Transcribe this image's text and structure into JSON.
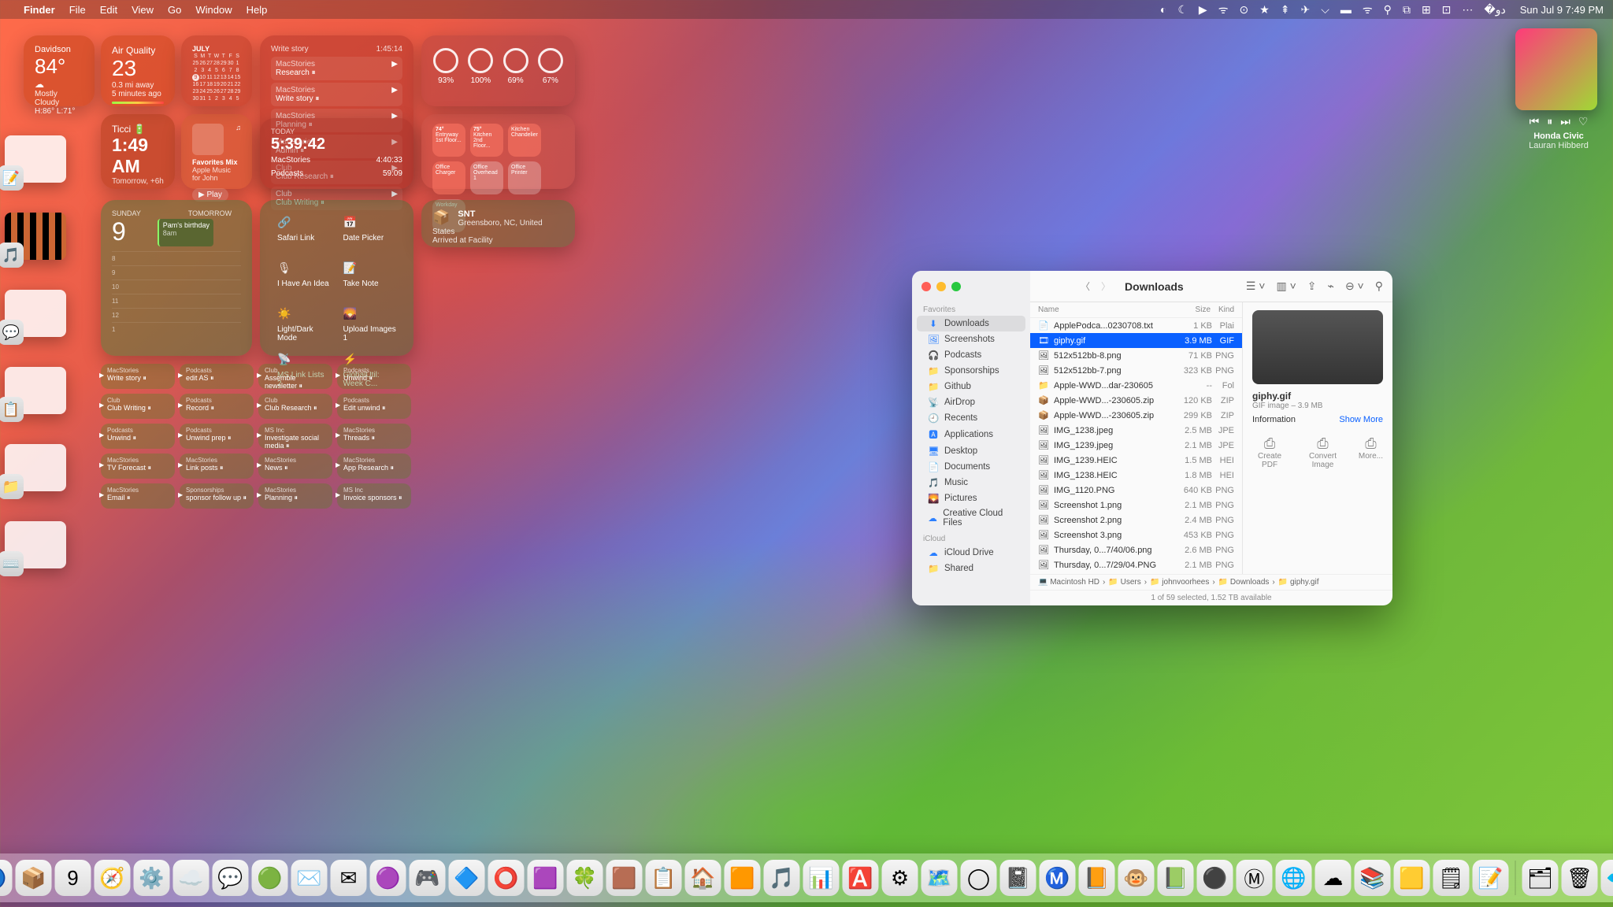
{
  "menubar": {
    "app": "Finder",
    "menus": [
      "File",
      "Edit",
      "View",
      "Go",
      "Window",
      "Help"
    ],
    "clock": "Sun Jul 9  7:49 PM"
  },
  "weather": {
    "loc": "Davidson",
    "deg": "84°",
    "cond": "Mostly Cloudy",
    "hilo": "H:86° L:71°"
  },
  "airquality": {
    "label": "Air Quality",
    "val": "23",
    "dist": "0.3 mi away",
    "ago": "5 minutes ago"
  },
  "calendar_mini": {
    "month": "JULY",
    "today": 9
  },
  "tasks": {
    "header_left": "Write story",
    "header_right": "1:45:14",
    "rows": [
      {
        "cat": "MacStories",
        "t": "Research"
      },
      {
        "cat": "MacStories",
        "t": "Write story"
      },
      {
        "cat": "MacStories",
        "t": "Planning"
      },
      {
        "cat": "MacStories",
        "t": "Admin"
      },
      {
        "cat": "Club",
        "t": "Club Research"
      },
      {
        "cat": "Club",
        "t": "Club Writing"
      }
    ]
  },
  "battery": {
    "labels": [
      "93%",
      "100%",
      "69%",
      "67%"
    ]
  },
  "clock": {
    "name": "Ticci",
    "time": "1:49 AM",
    "sub": "Tomorrow, +6h"
  },
  "music": {
    "title": "Favorites Mix",
    "sub": "Apple Music for John",
    "play": "▶ Play"
  },
  "podcast": {
    "today_label": "TODAY",
    "elapsed": "5:39:42",
    "rows": [
      [
        "MacStories",
        "4:40:33"
      ],
      [
        "Podcasts",
        "59:09"
      ]
    ]
  },
  "home_tiles": [
    {
      "t": "74°",
      "s": "Entryway 1st Floor..."
    },
    {
      "t": "75°",
      "s": "Kitchen 2nd Floor..."
    },
    {
      "t": "",
      "s": "Kitchen Chandelier"
    },
    {
      "t": "",
      "s": "Office Charger"
    },
    {
      "t": "",
      "s": "Office Overhead 1"
    },
    {
      "t": "",
      "s": "Office Printer"
    },
    {
      "t": "",
      "s": "Workday"
    }
  ],
  "big_cal": {
    "day_label": "SUNDAY",
    "daynum": "9",
    "tomorrow": "TOMORROW",
    "ev1": "Pam's birthday",
    "ev2": "8am",
    "hours": [
      "8",
      "9",
      "10",
      "11",
      "12",
      "1"
    ]
  },
  "shortcuts_cells": [
    {
      "ic": "🔗",
      "t": "Safari Link"
    },
    {
      "ic": "📅",
      "t": "Date Picker"
    },
    {
      "ic": "🎙",
      "t": "I Have An Idea"
    },
    {
      "ic": "📝",
      "t": "Take Note"
    },
    {
      "ic": "☀️",
      "t": "Light/Dark Mode"
    },
    {
      "ic": "🌄",
      "t": "Upload Images 1"
    },
    {
      "ic": "📡",
      "t": "MS Link Lists 2"
    },
    {
      "ic": "⚡",
      "t": "GlobalUtil: Week C..."
    }
  ],
  "ship": {
    "code": "SNT",
    "loc": "Greensboro, NC, United States",
    "status": "Arrived at Facility"
  },
  "notes": [
    {
      "c": "MacStories",
      "t": "Write story ⏸"
    },
    {
      "c": "Podcasts",
      "t": "edit AS ⏸"
    },
    {
      "c": "Club",
      "t": "Assemble newsletter ⏸"
    },
    {
      "c": "Podcasts",
      "t": "Unwind ⏸"
    },
    {
      "c": "Club",
      "t": "Club Writing ⏸"
    },
    {
      "c": "Podcasts",
      "t": "Record ⏸"
    },
    {
      "c": "Club",
      "t": "Club Research ⏸"
    },
    {
      "c": "Podcasts",
      "t": "Edit unwind ⏸"
    },
    {
      "c": "Podcasts",
      "t": "Unwind ⏸"
    },
    {
      "c": "Podcasts",
      "t": "Unwind prep ⏸"
    },
    {
      "c": "MS Inc",
      "t": "Investigate social media ⏸"
    },
    {
      "c": "MacStories",
      "t": "Threads ⏸"
    },
    {
      "c": "MacStories",
      "t": "TV Forecast ⏸"
    },
    {
      "c": "MacStories",
      "t": "Link posts ⏸"
    },
    {
      "c": "MacStories",
      "t": "News ⏸"
    },
    {
      "c": "MacStories",
      "t": "App Research ⏸"
    },
    {
      "c": "MacStories",
      "t": "Email ⏸"
    },
    {
      "c": "Sponsorships",
      "t": "sponsor follow up ⏸"
    },
    {
      "c": "MacStories",
      "t": "Planning ⏸"
    },
    {
      "c": "MS Inc",
      "t": "Invoice sponsors ⏸"
    }
  ],
  "now_playing": {
    "title": "Honda Civic",
    "artist": "Lauran Hibberd"
  },
  "finder": {
    "title": "Downloads",
    "sidebar": {
      "sec_fav": "Favorites",
      "fav": [
        {
          "ic": "⬇",
          "t": "Downloads",
          "sel": true
        },
        {
          "ic": "🖼",
          "t": "Screenshots"
        },
        {
          "ic": "🎧",
          "t": "Podcasts"
        },
        {
          "ic": "📁",
          "t": "Sponsorships"
        },
        {
          "ic": "📁",
          "t": "Github"
        },
        {
          "ic": "📡",
          "t": "AirDrop"
        },
        {
          "ic": "🕘",
          "t": "Recents"
        },
        {
          "ic": "🅰",
          "t": "Applications"
        },
        {
          "ic": "🖥",
          "t": "Desktop"
        },
        {
          "ic": "📄",
          "t": "Documents"
        },
        {
          "ic": "🎵",
          "t": "Music"
        },
        {
          "ic": "🌄",
          "t": "Pictures"
        },
        {
          "ic": "☁",
          "t": "Creative Cloud Files"
        }
      ],
      "sec_icloud": "iCloud",
      "icloud": [
        {
          "ic": "☁",
          "t": "iCloud Drive"
        },
        {
          "ic": "📁",
          "t": "Shared"
        }
      ]
    },
    "cols": {
      "name": "Name",
      "size": "Size",
      "kind": "Kind"
    },
    "files": [
      {
        "ic": "📄",
        "n": "ApplePodca...0230708.txt",
        "s": "1 KB",
        "k": "Plai"
      },
      {
        "ic": "🎞",
        "n": "giphy.gif",
        "s": "3.9 MB",
        "k": "GIF",
        "sel": true
      },
      {
        "ic": "🖼",
        "n": "512x512bb-8.png",
        "s": "71 KB",
        "k": "PNG"
      },
      {
        "ic": "🖼",
        "n": "512x512bb-7.png",
        "s": "323 KB",
        "k": "PNG"
      },
      {
        "ic": "📁",
        "n": "Apple-WWD...dar-230605",
        "s": "--",
        "k": "Fol"
      },
      {
        "ic": "📦",
        "n": "Apple-WWD...-230605.zip",
        "s": "120 KB",
        "k": "ZIP"
      },
      {
        "ic": "📦",
        "n": "Apple-WWD...-230605.zip",
        "s": "299 KB",
        "k": "ZIP"
      },
      {
        "ic": "🖼",
        "n": "IMG_1238.jpeg",
        "s": "2.5 MB",
        "k": "JPE"
      },
      {
        "ic": "🖼",
        "n": "IMG_1239.jpeg",
        "s": "2.1 MB",
        "k": "JPE"
      },
      {
        "ic": "🖼",
        "n": "IMG_1239.HEIC",
        "s": "1.5 MB",
        "k": "HEI"
      },
      {
        "ic": "🖼",
        "n": "IMG_1238.HEIC",
        "s": "1.8 MB",
        "k": "HEI"
      },
      {
        "ic": "🖼",
        "n": "IMG_1120.PNG",
        "s": "640 KB",
        "k": "PNG"
      },
      {
        "ic": "🖼",
        "n": "Screenshot 1.png",
        "s": "2.1 MB",
        "k": "PNG"
      },
      {
        "ic": "🖼",
        "n": "Screenshot 2.png",
        "s": "2.4 MB",
        "k": "PNG"
      },
      {
        "ic": "🖼",
        "n": "Screenshot 3.png",
        "s": "453 KB",
        "k": "PNG"
      },
      {
        "ic": "🖼",
        "n": "Thursday, 0...7/40/06.png",
        "s": "2.6 MB",
        "k": "PNG"
      },
      {
        "ic": "🖼",
        "n": "Thursday, 0...7/29/04.PNG",
        "s": "2.1 MB",
        "k": "PNG"
      }
    ],
    "preview": {
      "name": "giphy.gif",
      "meta": "GIF image – 3.9 MB",
      "info": "Information",
      "more": "Show More",
      "actions": [
        "Create PDF",
        "Convert Image",
        "More..."
      ]
    },
    "path": [
      "Macintosh HD",
      "Users",
      "johnvoorhees",
      "Downloads",
      "giphy.gif"
    ],
    "status": "1 of 59 selected, 1.52 TB available"
  },
  "dock_apps": [
    "🔵",
    "📦",
    "9",
    "🧭",
    "⚙️",
    "☁️",
    "💬",
    "🟢",
    "✉️",
    "✉︎",
    "🟣",
    "🎮",
    "🔷",
    "⭕",
    "🟪",
    "🍀",
    "🟫",
    "📋",
    "🏠",
    "🟧",
    "🎵",
    "📊",
    "🅰️",
    "⚙︎",
    "🗺️",
    "◯",
    "📓",
    "Ⓜ️",
    "📙",
    "🐵",
    "📗",
    "⚫",
    "Ⓜ",
    "🌐",
    "☁︎",
    "📚",
    "🟨",
    "🗒",
    "📝",
    "🗂",
    "🗑",
    "💠"
  ]
}
